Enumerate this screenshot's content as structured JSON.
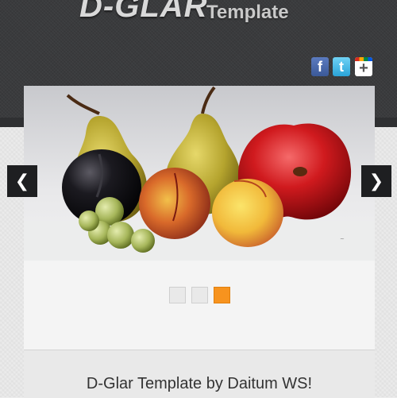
{
  "header": {
    "logo_main": "D-GLAR",
    "logo_sub": "Template"
  },
  "social": [
    {
      "name": "facebook",
      "glyph": "f",
      "icon": "facebook-icon"
    },
    {
      "name": "twitter",
      "glyph": "t",
      "icon": "twitter-icon"
    },
    {
      "name": "google-plus",
      "glyph": "+",
      "icon": "google-plus-icon"
    }
  ],
  "slider": {
    "prev_glyph": "❮",
    "next_glyph": "❯",
    "active_slide": 3,
    "slide_count": 3,
    "image_subject": "still-life-fruit-painting"
  },
  "caption": {
    "text": "D-Glar Template by Daitum WS!"
  },
  "colors": {
    "accent": "#f7931e",
    "header_bg": "#3a3b3d",
    "arrow_bg": "#1e1f21"
  }
}
